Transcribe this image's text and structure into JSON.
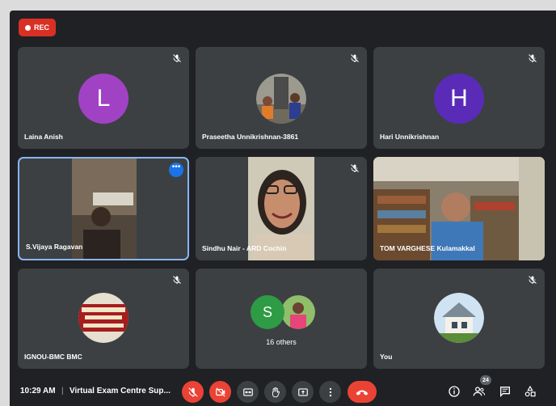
{
  "recording": {
    "label": "REC"
  },
  "participants": [
    {
      "name": "Laina Anish",
      "initial": "L",
      "color": "#a142c4",
      "muted": true
    },
    {
      "name": "Praseetha Unnikrishnan-3861",
      "muted": true
    },
    {
      "name": "Hari Unnikrishnan",
      "initial": "H",
      "color": "#5a2bb7",
      "muted": true
    },
    {
      "name": "S.Vijaya Ragavan",
      "muted": false
    },
    {
      "name": "Sindhu Nair - ARD Cochin",
      "muted": true
    },
    {
      "name": "TOM VARGHESE Kulamakkal",
      "muted": false
    },
    {
      "name": "IGNOU-BMC BMC",
      "muted": true
    },
    {
      "name": "You",
      "muted": true
    }
  ],
  "logo_text": "INDIRA GANDHI NATIONAL OPEN UNIVERSITY BHARATA MATA COLLEGE",
  "others": {
    "initial": "S",
    "color": "#2e9b45",
    "label": "16 others"
  },
  "bottom_bar": {
    "time": "10:29 AM",
    "separator": "|",
    "meeting_title": "Virtual Exam Centre Sup...",
    "people_count": "24"
  }
}
